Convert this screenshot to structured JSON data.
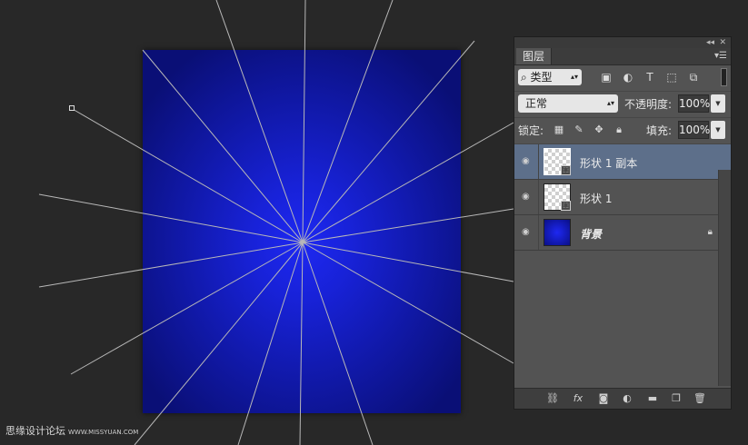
{
  "canvas": {
    "ray_color": "#b8b8b8",
    "watermark_text": "思缘设计论坛",
    "watermark_url": "WWW.MISSYUAN.COM"
  },
  "panel": {
    "tab_label": "图层",
    "filter": {
      "value": "类型",
      "icons": [
        "image-filter-icon",
        "adjustment-filter-icon",
        "text-filter-icon",
        "shape-filter-icon",
        "smart-object-filter-icon"
      ]
    },
    "blend_mode": "正常",
    "opacity_label": "不透明度:",
    "opacity_value": "100%",
    "lock_label": "锁定:",
    "fill_label": "填充:",
    "fill_value": "100%",
    "layers": [
      {
        "name": "形状 1 副本",
        "selected": true,
        "type": "shape"
      },
      {
        "name": "形状 1",
        "selected": false,
        "type": "shape"
      },
      {
        "name": "背景",
        "selected": false,
        "type": "background",
        "locked": true
      }
    ],
    "colors": {
      "selected_row": "#5d6f8a",
      "panel_bg": "#535353",
      "canvas_blue": "#1e28f2"
    }
  }
}
